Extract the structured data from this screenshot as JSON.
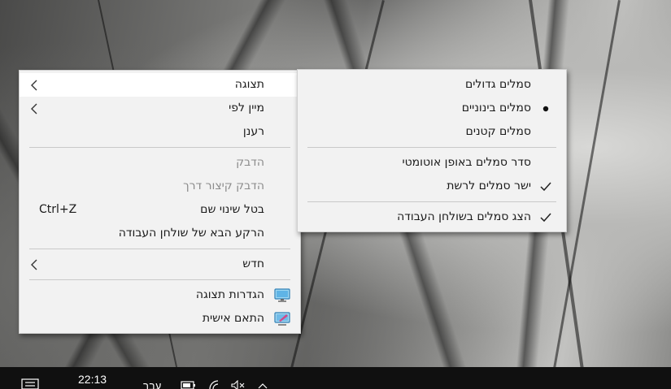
{
  "main_menu": {
    "items": [
      {
        "label": "תצוגה"
      },
      {
        "label": "מיין לפי"
      },
      {
        "label": "רענן"
      },
      {
        "label": "הדבק"
      },
      {
        "label": "הדבק קיצור דרך"
      },
      {
        "label": "בטל שינוי שם",
        "shortcut": "Ctrl+Z"
      },
      {
        "label": "הרקע הבא של שולחן העבודה"
      },
      {
        "label": "חדש"
      },
      {
        "label": "הגדרות תצוגה",
        "icon": "display-settings-icon"
      },
      {
        "label": "התאם אישית",
        "icon": "personalize-icon"
      }
    ]
  },
  "view_submenu": {
    "items": [
      {
        "label": "סמלים גדולים"
      },
      {
        "label": "סמלים בינוניים",
        "state": "selected-bullet"
      },
      {
        "label": "סמלים קטנים"
      },
      {
        "label": "סדר סמלים באופן אוטומטי"
      },
      {
        "label": "ישר סמלים לרשת",
        "state": "checked"
      },
      {
        "label": "הצג סמלים בשולחן העבודה",
        "state": "checked"
      }
    ]
  },
  "taskbar": {
    "time": "22:13",
    "language": "עבר"
  },
  "colors": {
    "menu_bg": "#f2f2f2",
    "menu_highlight": "#ffffff",
    "disabled_text": "#8c8c8c",
    "taskbar_bg": "#101010"
  }
}
